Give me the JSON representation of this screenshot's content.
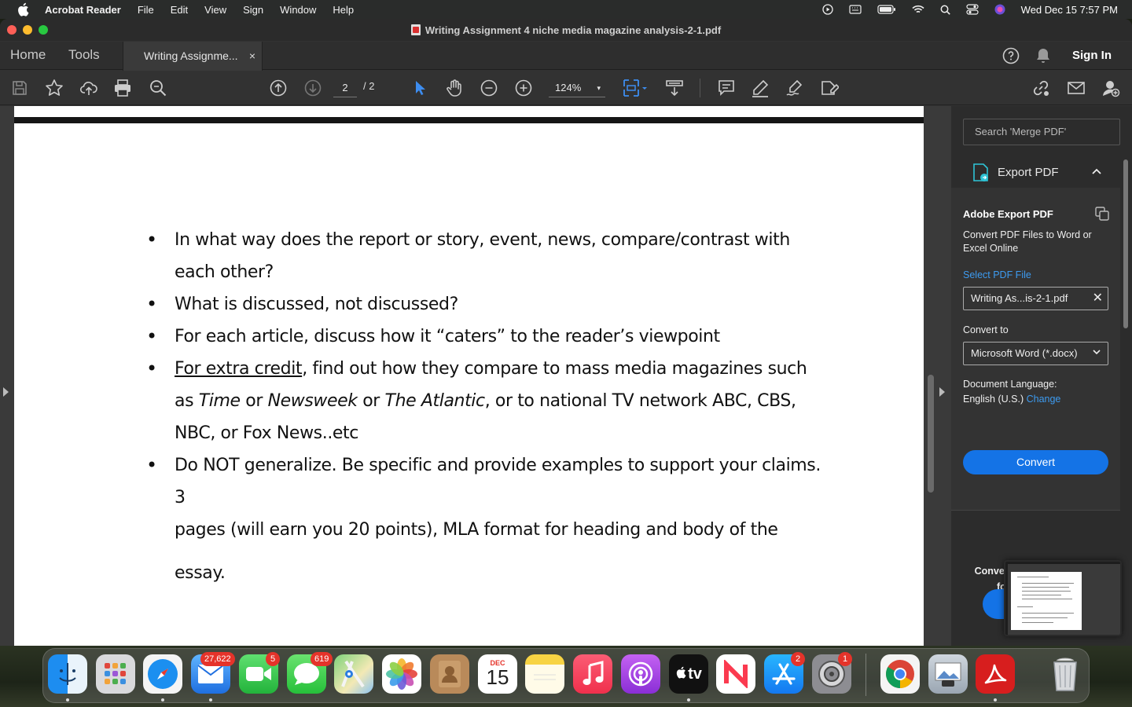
{
  "menubar": {
    "app_name": "Acrobat Reader",
    "menus": [
      "File",
      "Edit",
      "View",
      "Sign",
      "Window",
      "Help"
    ],
    "clock": "Wed Dec 15  7:57 PM"
  },
  "window": {
    "title": "Writing Assignment 4 niche media magazine analysis-2-1.pdf"
  },
  "tabs": {
    "home": "Home",
    "tools": "Tools",
    "doc_tab": "Writing Assignme...",
    "close": "×",
    "sign_in": "Sign In"
  },
  "toolbar": {
    "page_current": "2",
    "page_total": "/ 2",
    "zoom": "124%",
    "zoom_caret": "▾"
  },
  "document": {
    "bullet": "•",
    "b1": "In what way does the report or story, event, news, compare/contrast with each other?",
    "b2": "What is discussed, not discussed?",
    "b3": "For each article, discuss how it “caters” to the reader’s viewpoint",
    "b4_link": "For extra credit",
    "b4_a": ", find out how they compare to mass media magazines such as ",
    "b4_time": "Time",
    "b4_or1": " or ",
    "b4_newsweek": "Newsweek",
    "b4_or2": " or ",
    "b4_atlantic": "The Atlantic",
    "b4_b": ", or to national TV network ABC, CBS, NBC, or Fox News..etc",
    "b5": "Do NOT generalize. Be specific and provide examples to support your claims. 3",
    "b5_cont": "pages (will earn you 20 points), MLA format for heading and body of the essay."
  },
  "right_pane": {
    "search_placeholder": "Search 'Merge PDF'",
    "export_label": "Export PDF",
    "chevron": "⌃",
    "panel_title": "Adobe Export PDF",
    "panel_desc": "Convert PDF Files to Word or Excel Online",
    "select_label": "Select PDF File",
    "file_name": "Writing As...is-2-1.pdf",
    "file_clear": "✕",
    "convert_to_label": "Convert to",
    "format": "Microsoft Word (*.docx)",
    "format_caret": "⌄",
    "lang_label": "Document Language:",
    "lang_value": "English (U.S.)",
    "lang_change": "Change",
    "convert_button": "Convert",
    "promo": "Convert, edit and e-sign PDF",
    "promo_cont": "fo"
  },
  "dock": {
    "mail_badge": "27,622",
    "facetime_badge": "5",
    "messages_badge": "619",
    "appstore_badge": "2",
    "settings_badge": "1",
    "calendar_month": "DEC",
    "calendar_day": "15",
    "tv_label": "tv"
  },
  "colors": {
    "accent_blue": "#1473e6",
    "link_blue": "#3d9bf0",
    "badge_red": "#e5332a",
    "pdf_red": "#d71e1e"
  }
}
